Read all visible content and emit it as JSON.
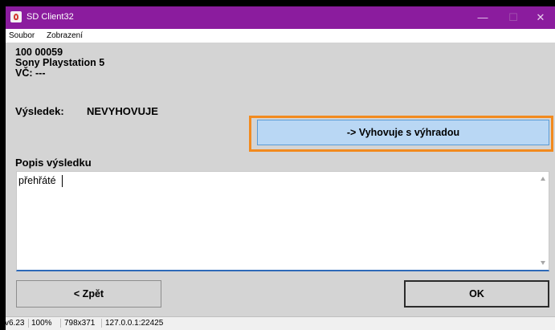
{
  "window": {
    "title": "SD Client32",
    "minimize_glyph": "—",
    "maximize_glyph": "☐",
    "close_glyph": "✕",
    "titlebar_color": "#8b1c9e"
  },
  "menu": {
    "items": [
      "Soubor",
      "Zobrazení"
    ]
  },
  "device": {
    "id": "100 00059",
    "name": "Sony Playstation 5",
    "serial_line": "VČ: ---"
  },
  "result": {
    "label": "Výsledek:",
    "value": "NEVYHOVUJE"
  },
  "actions": {
    "accept_with_reservation": "-> Vyhovuje s výhradou",
    "highlight_color": "#f28a1e",
    "back": "< Zpět",
    "ok": "OK"
  },
  "description": {
    "label": "Popis výsledku",
    "value": "přehřáté"
  },
  "status": {
    "version": "v6.23",
    "zoom": "100%",
    "resolution": "798x371",
    "address": "127.0.0.1:22425"
  }
}
